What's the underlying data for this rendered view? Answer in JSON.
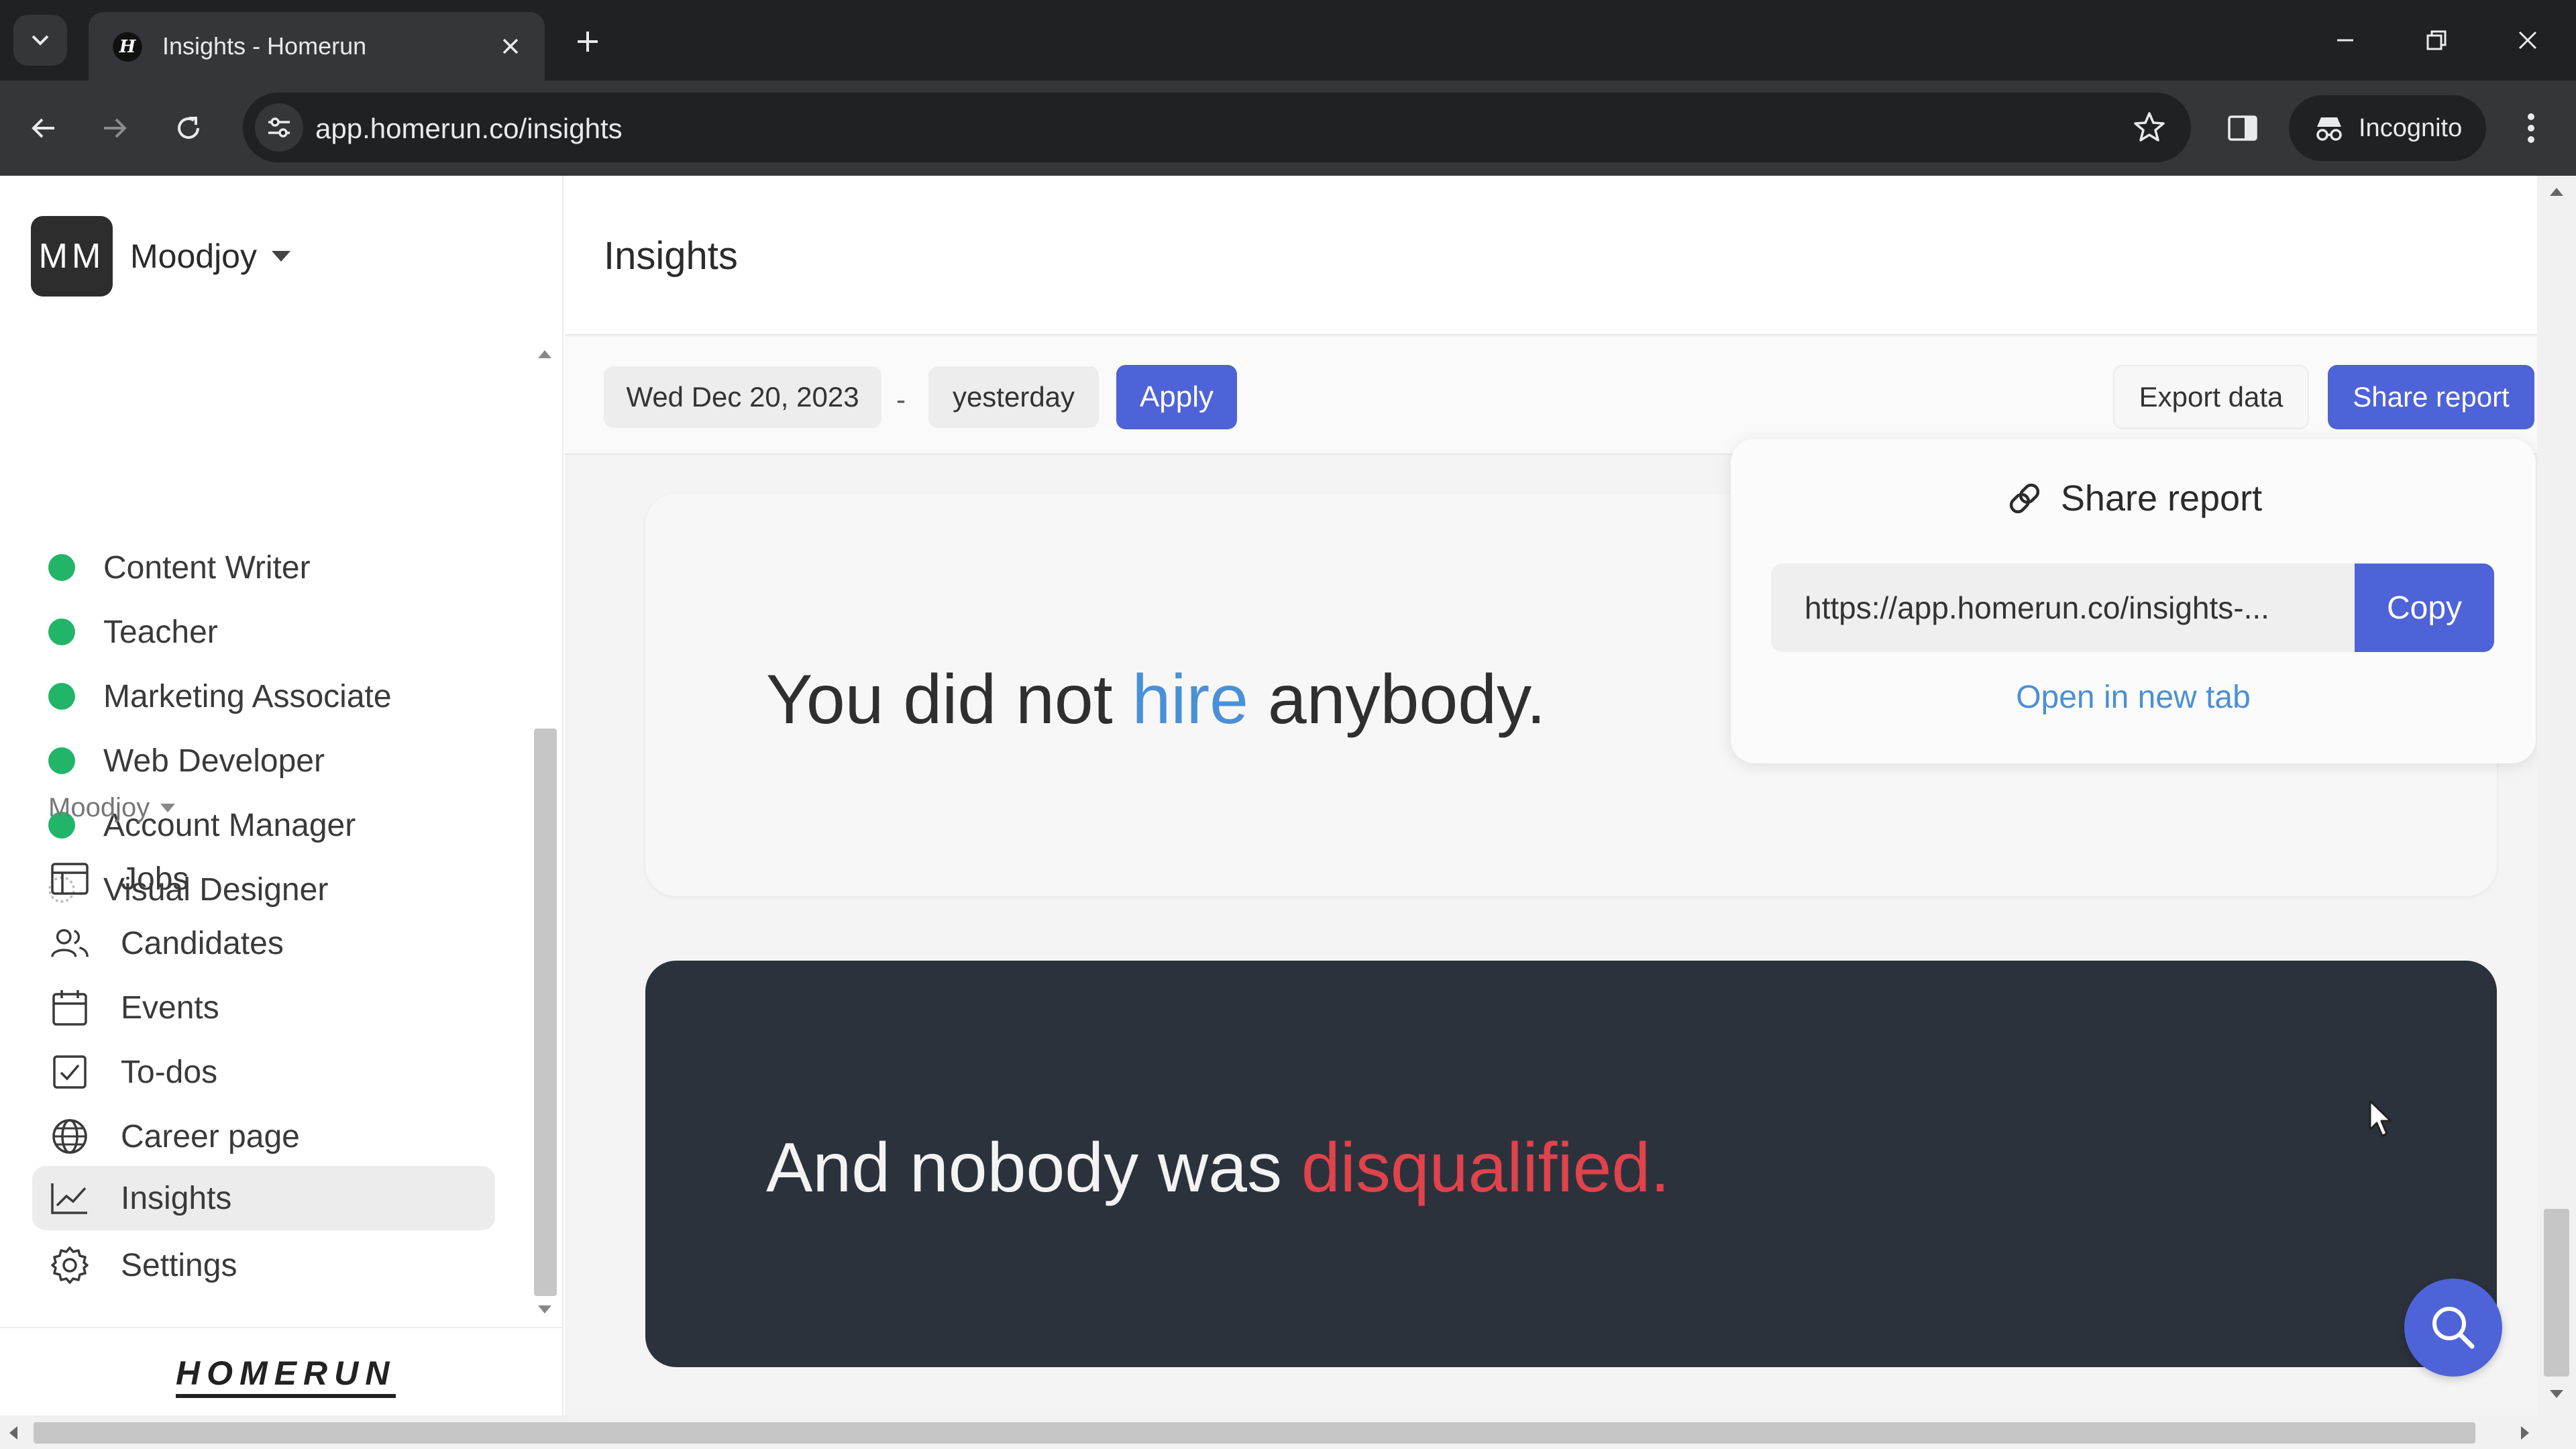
{
  "browser": {
    "tab_title": "Insights - Homerun",
    "favicon_letter": "H",
    "url": "app.homerun.co/insights",
    "incognito_label": "Incognito"
  },
  "workspace": {
    "initials": "MM",
    "name": "Moodjoy"
  },
  "jobs": [
    {
      "label": "Content Writer",
      "status": "published"
    },
    {
      "label": "Teacher",
      "status": "published"
    },
    {
      "label": "Marketing Associate",
      "status": "published"
    },
    {
      "label": "Web Developer",
      "status": "published"
    },
    {
      "label": "Account Manager",
      "status": "published"
    },
    {
      "label": "Visual Designer",
      "status": "draft"
    }
  ],
  "nav": {
    "section_label": "Moodjoy",
    "items": [
      {
        "label": "Jobs",
        "icon": "jobs-icon"
      },
      {
        "label": "Candidates",
        "icon": "candidates-icon"
      },
      {
        "label": "Events",
        "icon": "calendar-icon"
      },
      {
        "label": "To-dos",
        "icon": "checkbox-icon"
      },
      {
        "label": "Career page",
        "icon": "globe-icon"
      },
      {
        "label": "Insights",
        "icon": "chart-icon",
        "active": true
      },
      {
        "label": "Settings",
        "icon": "gear-icon"
      }
    ]
  },
  "logo_text": "HOMERUN",
  "page": {
    "title": "Insights"
  },
  "filters": {
    "start_date": "Wed Dec 20, 2023",
    "separator": "-",
    "end_date": "yesterday",
    "apply_label": "Apply",
    "export_label": "Export data",
    "share_label": "Share report"
  },
  "cards": {
    "hire": {
      "prefix": "You did not ",
      "highlight": "hire",
      "suffix": " anybody."
    },
    "disqualified": {
      "prefix": "And nobody was ",
      "highlight": "disqualified."
    }
  },
  "share_popover": {
    "title": "Share report",
    "link": "https://app.homerun.co/insights-...",
    "copy_label": "Copy",
    "open_label": "Open in new tab"
  },
  "colors": {
    "primary": "#4e63d8",
    "highlight_blue": "#4a90d6",
    "highlight_red": "#e0434b",
    "status_green": "#22b56a",
    "dark_card": "#2b323c"
  }
}
